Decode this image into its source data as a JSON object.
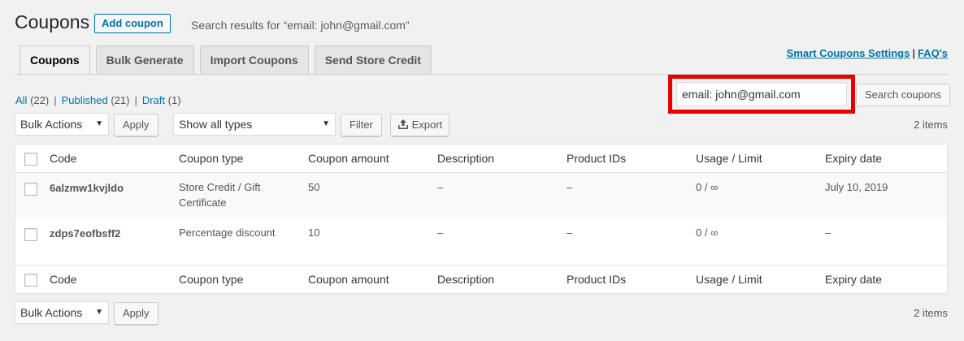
{
  "header": {
    "title": "Coupons",
    "add_button": "Add coupon",
    "subtitle": "Search results for “email: john@gmail.com”"
  },
  "tabs": [
    {
      "label": "Coupons",
      "active": true
    },
    {
      "label": "Bulk Generate",
      "active": false
    },
    {
      "label": "Import Coupons",
      "active": false
    },
    {
      "label": "Send Store Credit",
      "active": false
    }
  ],
  "top_links": {
    "settings": "Smart Coupons Settings",
    "separator": "|",
    "faq": "FAQ's"
  },
  "filters_links": {
    "all": "All",
    "all_count": "(22)",
    "published": "Published",
    "published_count": "(21)",
    "draft": "Draft",
    "draft_count": "(1)",
    "separator": "|"
  },
  "search": {
    "value": "email: john@gmail.com",
    "button": "Search coupons"
  },
  "toolbar_top": {
    "bulk_actions": "Bulk Actions",
    "apply": "Apply",
    "type_filter": "Show all types",
    "filter": "Filter",
    "export": "Export",
    "items_count": "2 items"
  },
  "table": {
    "columns": [
      "Code",
      "Coupon type",
      "Coupon amount",
      "Description",
      "Product IDs",
      "Usage / Limit",
      "Expiry date"
    ],
    "rows": [
      {
        "code": "6alzmw1kvjldo",
        "type_line1": "Store Credit / Gift",
        "type_line2": "Certificate",
        "amount": "50",
        "description": "–",
        "product_ids": "–",
        "usage": "0 / ∞",
        "expiry": "July 10, 2019"
      },
      {
        "code": "zdps7eofbsff2",
        "type_line1": "Percentage discount",
        "type_line2": "",
        "amount": "10",
        "description": "–",
        "product_ids": "–",
        "usage": "0 / ∞",
        "expiry": "–"
      }
    ]
  },
  "toolbar_bottom": {
    "bulk_actions": "Bulk Actions",
    "apply": "Apply",
    "items_count": "2 items"
  },
  "colors": {
    "link": "#0073aa",
    "highlight": "#e60000",
    "background": "#f1f1f1"
  }
}
